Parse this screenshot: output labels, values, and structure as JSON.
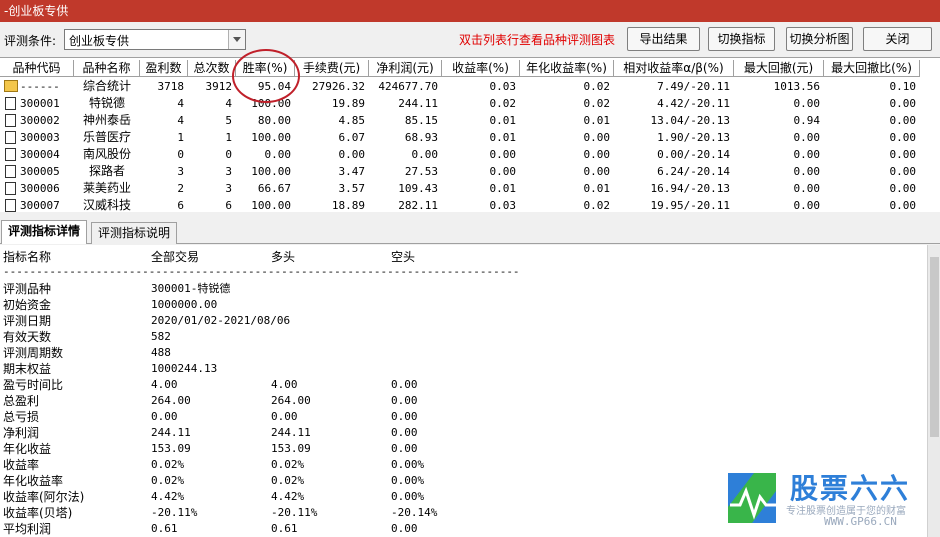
{
  "window": {
    "title": "-创业板专供"
  },
  "toolbar": {
    "condition_label": "评测条件:",
    "condition_value": "创业板专供",
    "hint": "双击列表行查看品种评测图表",
    "export_label": "导出结果",
    "switch_indicator_label": "切换指标",
    "switch_chart_label": "切换分析图",
    "close_label": "关闭"
  },
  "table": {
    "headers": [
      "品种代码",
      "品种名称",
      "盈利数",
      "总次数",
      "胜率(%)",
      "手续费(元)",
      "净利润(元)",
      "收益率(%)",
      "年化收益率(%)",
      "相对收益率α/β(%)",
      "最大回撤(元)",
      "最大回撤比(%)"
    ],
    "rows": [
      {
        "icon": "folder-icon",
        "code": "------",
        "name": "综合统计",
        "wins": "3718",
        "total": "3912",
        "winrate": "95.04",
        "fee": "27926.32",
        "net": "424677.70",
        "ret": "0.03",
        "annual": "0.02",
        "rel": "7.49/-20.11",
        "maxdd": "1013.56",
        "maxddr": "0.10"
      },
      {
        "icon": "document-icon",
        "code": "300001",
        "name": "特锐德",
        "wins": "4",
        "total": "4",
        "winrate": "100.00",
        "fee": "19.89",
        "net": "244.11",
        "ret": "0.02",
        "annual": "0.02",
        "rel": "4.42/-20.11",
        "maxdd": "0.00",
        "maxddr": "0.00"
      },
      {
        "icon": "document-icon",
        "code": "300002",
        "name": "神州泰岳",
        "wins": "4",
        "total": "5",
        "winrate": "80.00",
        "fee": "4.85",
        "net": "85.15",
        "ret": "0.01",
        "annual": "0.01",
        "rel": "13.04/-20.13",
        "maxdd": "0.94",
        "maxddr": "0.00"
      },
      {
        "icon": "document-icon",
        "code": "300003",
        "name": "乐普医疗",
        "wins": "1",
        "total": "1",
        "winrate": "100.00",
        "fee": "6.07",
        "net": "68.93",
        "ret": "0.01",
        "annual": "0.00",
        "rel": "1.90/-20.13",
        "maxdd": "0.00",
        "maxddr": "0.00"
      },
      {
        "icon": "document-icon",
        "code": "300004",
        "name": "南风股份",
        "wins": "0",
        "total": "0",
        "winrate": "0.00",
        "fee": "0.00",
        "net": "0.00",
        "ret": "0.00",
        "annual": "0.00",
        "rel": "0.00/-20.14",
        "maxdd": "0.00",
        "maxddr": "0.00"
      },
      {
        "icon": "document-icon",
        "code": "300005",
        "name": "探路者",
        "wins": "3",
        "total": "3",
        "winrate": "100.00",
        "fee": "3.47",
        "net": "27.53",
        "ret": "0.00",
        "annual": "0.00",
        "rel": "6.24/-20.14",
        "maxdd": "0.00",
        "maxddr": "0.00"
      },
      {
        "icon": "document-icon",
        "code": "300006",
        "name": "莱美药业",
        "wins": "2",
        "total": "3",
        "winrate": "66.67",
        "fee": "3.57",
        "net": "109.43",
        "ret": "0.01",
        "annual": "0.01",
        "rel": "16.94/-20.13",
        "maxdd": "0.00",
        "maxddr": "0.00"
      },
      {
        "icon": "document-icon",
        "code": "300007",
        "name": "汉威科技",
        "wins": "6",
        "total": "6",
        "winrate": "100.00",
        "fee": "18.89",
        "net": "282.11",
        "ret": "0.03",
        "annual": "0.02",
        "rel": "19.95/-20.11",
        "maxdd": "0.00",
        "maxddr": "0.00"
      }
    ]
  },
  "tabs": [
    {
      "label": "评测指标详情",
      "active": true
    },
    {
      "label": "评测指标说明",
      "active": false
    }
  ],
  "detail": {
    "header": {
      "name": "指标名称",
      "all": "全部交易",
      "long": "多头",
      "short": "空头"
    },
    "separator": "------------------------------------------------------------------------------",
    "rows": [
      {
        "label": "评测品种",
        "v1": "300001-特锐德",
        "v2": "",
        "v3": ""
      },
      {
        "label": "初始资金",
        "v1": "1000000.00",
        "v2": "",
        "v3": ""
      },
      {
        "label": "评测日期",
        "v1": "2020/01/02-2021/08/06",
        "v2": "",
        "v3": ""
      },
      {
        "label": "有效天数",
        "v1": "582",
        "v2": "",
        "v3": ""
      },
      {
        "label": "评测周期数",
        "v1": "488",
        "v2": "",
        "v3": ""
      },
      {
        "label": "期末权益",
        "v1": "1000244.13",
        "v2": "",
        "v3": ""
      },
      {
        "label": "盈亏时间比",
        "v1": "4.00",
        "v2": "4.00",
        "v3": "0.00"
      },
      {
        "label": "总盈利",
        "v1": "264.00",
        "v2": "264.00",
        "v3": "0.00"
      },
      {
        "label": "总亏损",
        "v1": "0.00",
        "v2": "0.00",
        "v3": "0.00"
      },
      {
        "label": "净利润",
        "v1": "244.11",
        "v2": "244.11",
        "v3": "0.00"
      },
      {
        "label": "年化收益",
        "v1": "153.09",
        "v2": "153.09",
        "v3": "0.00"
      },
      {
        "label": "收益率",
        "v1": "0.02%",
        "v2": "0.02%",
        "v3": "0.00%"
      },
      {
        "label": "年化收益率",
        "v1": "0.02%",
        "v2": "0.02%",
        "v3": "0.00%"
      },
      {
        "label": "收益率(阿尔法)",
        "v1": "4.42%",
        "v2": "4.42%",
        "v3": "0.00%"
      },
      {
        "label": "收益率(贝塔)",
        "v1": "-20.11%",
        "v2": "-20.11%",
        "v3": "-20.14%"
      },
      {
        "label": "平均利润",
        "v1": "0.61",
        "v2": "0.61",
        "v3": "0.00"
      }
    ]
  },
  "watermark": {
    "name": "股票六六",
    "slogan": "专注股票创造属于您的财富",
    "url": "WWW.GP66.CN"
  },
  "colors": {
    "title_bar": "#c0392b",
    "hint_text": "#e00000",
    "highlight_ring": "#c0202a",
    "logo_blue": "#2e7fd8",
    "logo_green": "#39b54a"
  }
}
